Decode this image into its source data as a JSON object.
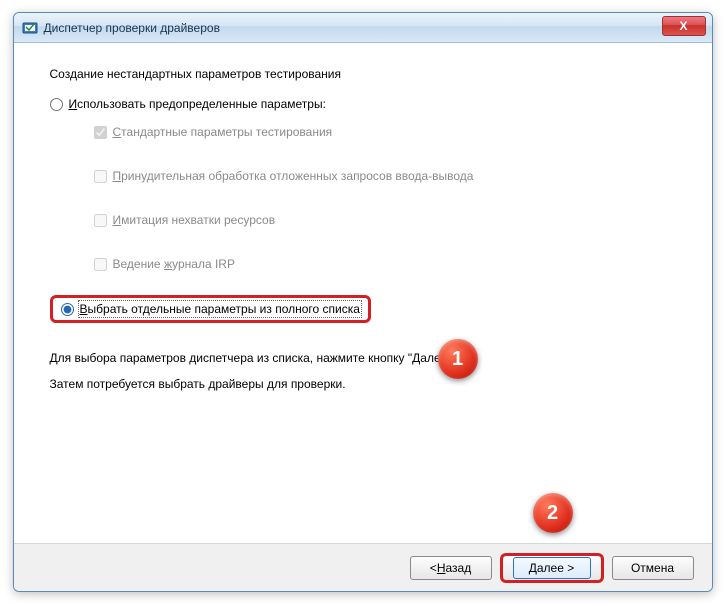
{
  "title": "Диспетчер проверки драйверов",
  "section_title": "Создание нестандартных параметров тестирования",
  "radio1_label": "Использовать предопределенные параметры:",
  "radio1_u": "И",
  "checks": [
    {
      "label": "Стандартные параметры тестирования",
      "u": "С",
      "checked": true
    },
    {
      "label": "Принудительная обработка отложенных запросов ввода-вывода",
      "u": "П",
      "checked": false
    },
    {
      "label": "Имитация нехватки ресурсов",
      "u": "И",
      "checked": false
    },
    {
      "label": "Ведение журнала IRP",
      "u": "ж",
      "checked": false
    }
  ],
  "radio2_label": "Выбрать отдельные параметры из полного списка",
  "radio2_u": "В",
  "instructions_line1": "Для выбора параметров диспетчера из списка, нажмите кнопку \"Далее.",
  "instructions_line2": "Затем потребуется выбрать драйверы для проверки.",
  "buttons": {
    "back": "< Назад",
    "back_u": "Н",
    "next": "Далее >",
    "next_u": "Д",
    "cancel": "Отмена"
  },
  "markers": {
    "one": "1",
    "two": "2"
  },
  "close_glyph": "X"
}
